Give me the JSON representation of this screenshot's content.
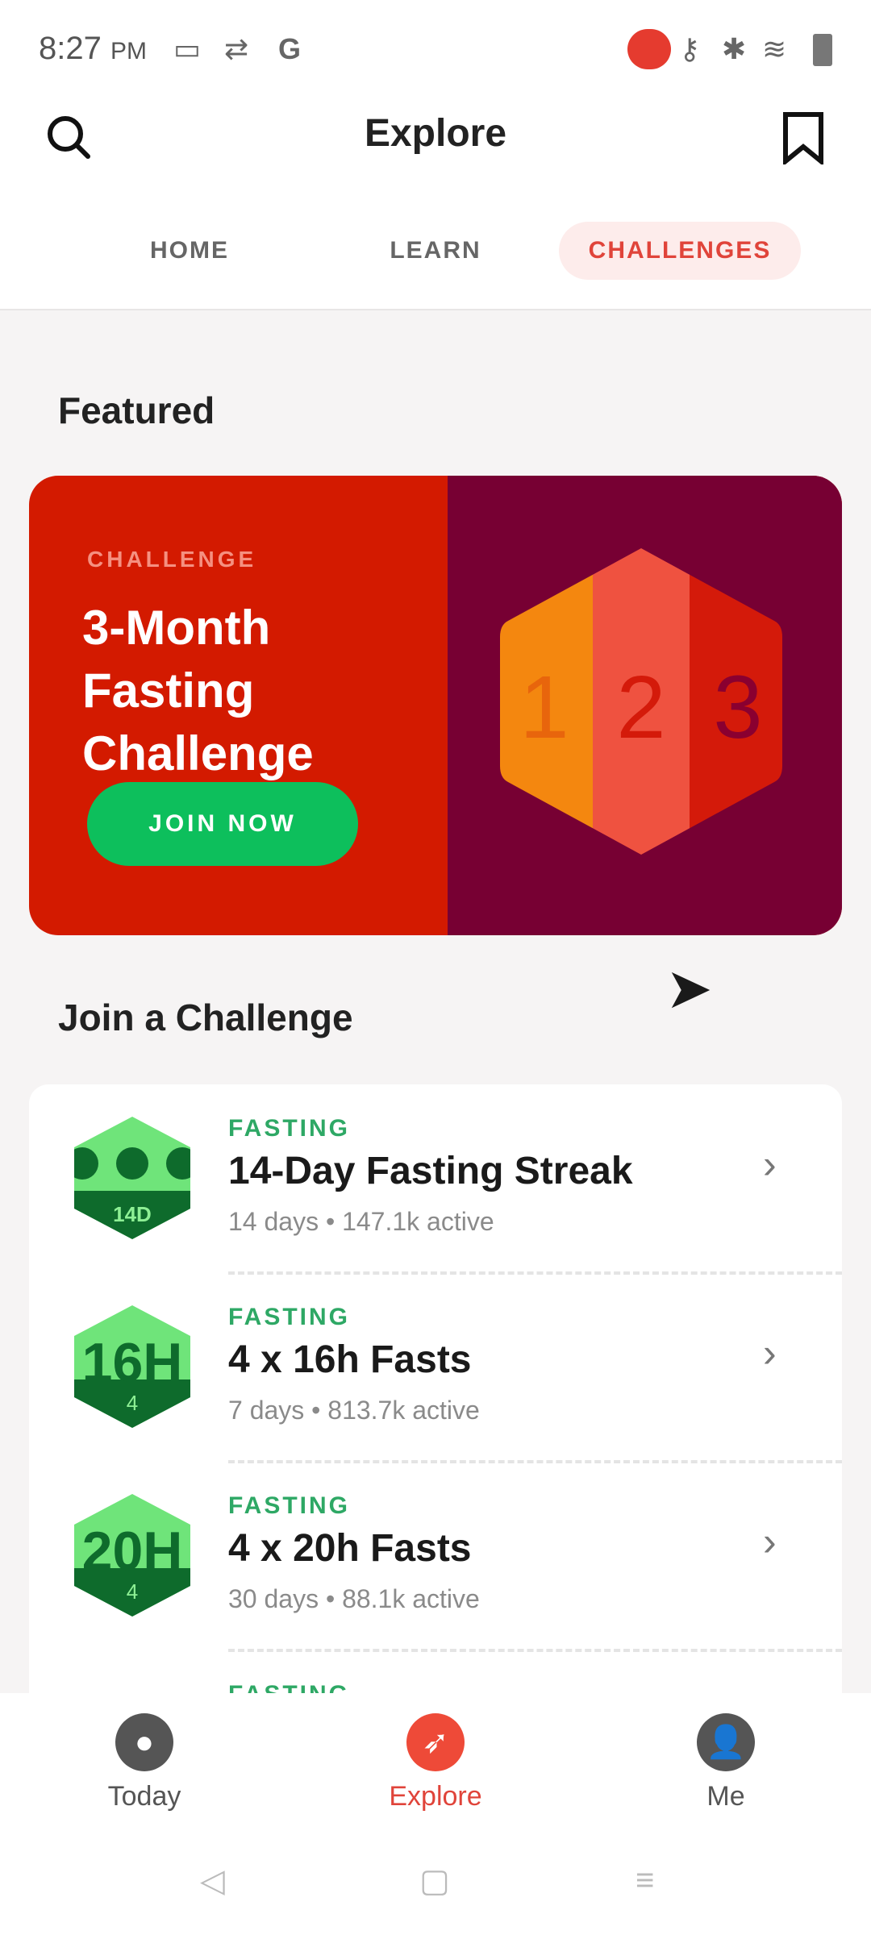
{
  "status": {
    "time": "8:27",
    "ampm": "PM"
  },
  "header": {
    "title": "Explore",
    "icons": [
      "search-icon",
      "bookmark-icon"
    ]
  },
  "tabs": [
    {
      "label": "HOME"
    },
    {
      "label": "LEARN"
    },
    {
      "label": "CHALLENGES",
      "active": true
    }
  ],
  "featured": {
    "section": "Featured",
    "kicker": "CHALLENGE",
    "headline": "3-Month Fasting Challenge",
    "button": "JOIN NOW",
    "badge_digits": [
      "1",
      "2",
      "3"
    ]
  },
  "join_section": "Join a Challenge",
  "challenges": [
    {
      "category": "FASTING",
      "title": "14-Day Fasting Streak",
      "meta": "14 days • 147.1k active",
      "badge": "14D"
    },
    {
      "category": "FASTING",
      "title": "4 x 16h Fasts",
      "meta": "7 days • 813.7k active",
      "badge": "16H",
      "badge_sub": "4"
    },
    {
      "category": "FASTING",
      "title": "4 x 20h Fasts",
      "meta": "30 days • 88.1k active",
      "badge": "20H",
      "badge_sub": "4"
    },
    {
      "category": "FASTING"
    }
  ],
  "nav": [
    {
      "label": "Today"
    },
    {
      "label": "Explore",
      "active": true
    },
    {
      "label": "Me"
    }
  ],
  "colors": {
    "accent": "#e0443a",
    "green": "#2ea865",
    "banner_red": "#d31a00",
    "banner_maroon": "#770033"
  }
}
